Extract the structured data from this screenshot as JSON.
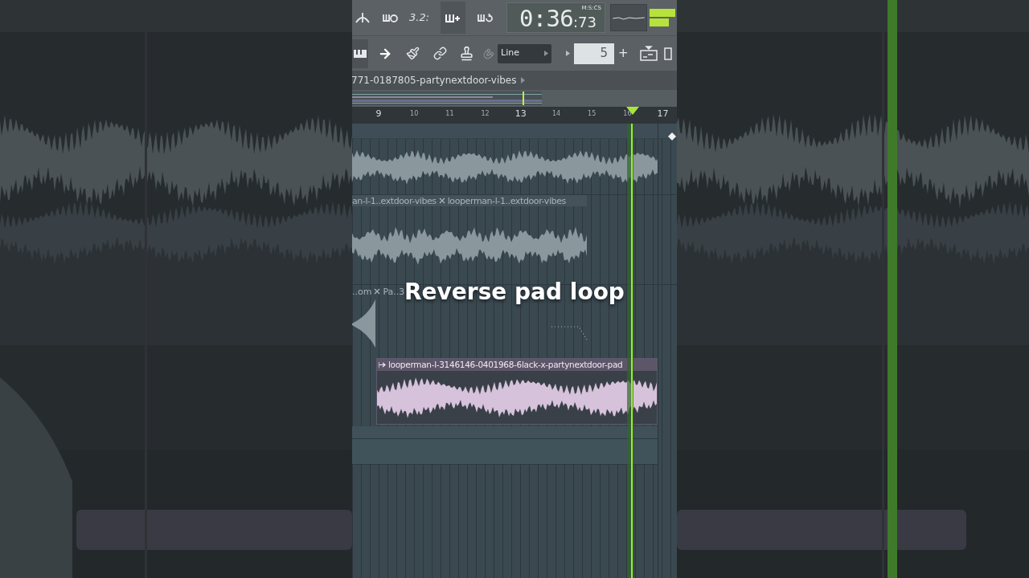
{
  "toolbar": {
    "time": "0:36",
    "centiseconds": ":73",
    "time_format": "M:S:CS",
    "beat_label": "3.2:",
    "snap_mode": "Line",
    "step": "5",
    "step_add": "+"
  },
  "playlist_title": "771-0187805-partynextdoor-vibes",
  "ruler": [
    {
      "label": "9",
      "major": true
    },
    {
      "label": "10",
      "major": false
    },
    {
      "label": "11",
      "major": false
    },
    {
      "label": "12",
      "major": false
    },
    {
      "label": "13",
      "major": true
    },
    {
      "label": "14",
      "major": false
    },
    {
      "label": "15",
      "major": false
    },
    {
      "label": "16",
      "major": false
    },
    {
      "label": "17",
      "major": true
    }
  ],
  "upper_clip_names": [
    "an-l-1..extdoor-vibes",
    "looperman-l-1..extdoor-vibes"
  ],
  "lower_clip_names": [
    "..om",
    "Pa..3"
  ],
  "pad_clip": {
    "name": "looperman-l-3146146-0401968-6lack-x-partynextdoor-pad",
    "selected": true
  },
  "caption": "Reverse pad loop"
}
